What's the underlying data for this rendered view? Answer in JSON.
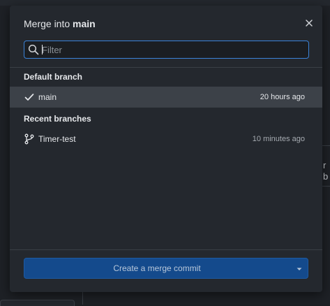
{
  "background": {
    "peek_text": "r b"
  },
  "dialog": {
    "title_prefix": "Merge into ",
    "title_branch": "main",
    "close_icon": "close-icon",
    "search": {
      "placeholder": "Filter",
      "value": ""
    },
    "sections": {
      "default_label": "Default branch",
      "recent_label": "Recent branches"
    },
    "default_branches": [
      {
        "name": "main",
        "time": "20 hours ago",
        "icon": "check-icon",
        "selected": true
      }
    ],
    "recent_branches": [
      {
        "name": "Timer-test",
        "time": "10 minutes ago",
        "icon": "git-branch-icon",
        "selected": false
      }
    ],
    "merge_button": {
      "label": "Create a merge commit",
      "dropdown_icon": "caret-down-icon"
    }
  },
  "colors": {
    "accent_border": "#3b83d8",
    "button_bg": "#144a8c",
    "dialog_bg": "#24282e",
    "selected_row": "#3c4148"
  }
}
